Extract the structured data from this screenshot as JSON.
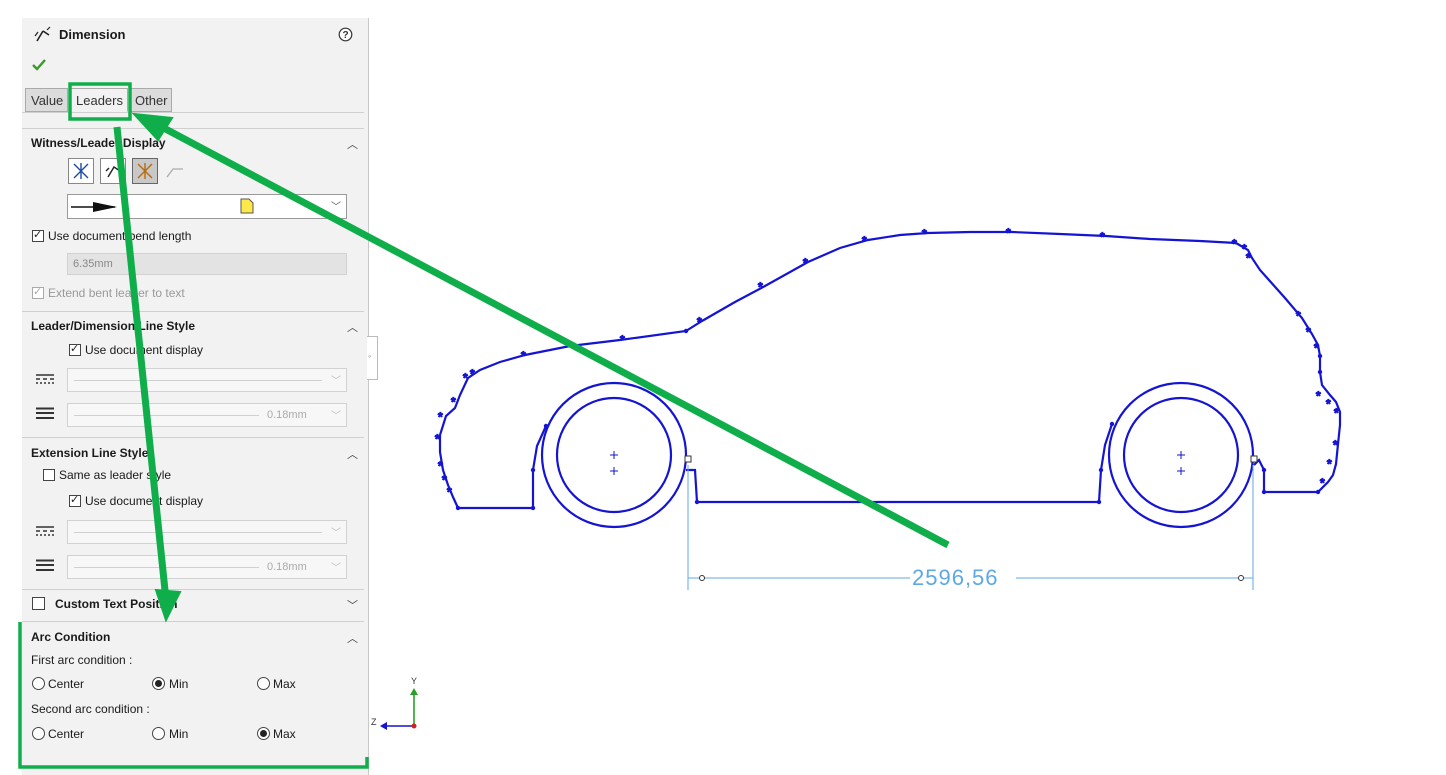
{
  "panel": {
    "title": "Dimension",
    "help_icon": "help-circle-icon",
    "ok_icon": "green-check-icon",
    "tabs": [
      {
        "label": "Value",
        "active": false
      },
      {
        "label": "Leaders",
        "active": true
      },
      {
        "label": "Other",
        "active": false
      }
    ],
    "witness_section": {
      "title": "Witness/Leader Display",
      "icons": [
        "outside-arrows-icon",
        "inside-arrows-icon",
        "smart-arrows-icon",
        "bent-leader-icon"
      ],
      "arrow_style_icon": "filled-arrow-style-icon",
      "use_document_bend_length": {
        "label": "Use document bend length",
        "checked": true
      },
      "bend_length_value": "6.35mm",
      "extend_bent_leader": {
        "label": "Extend bent leader to text",
        "checked": true,
        "enabled": false
      }
    },
    "leader_line_section": {
      "title": "Leader/Dimension Line Style",
      "use_document_display": {
        "label": "Use document display",
        "checked": true
      },
      "line_thickness_value": "0.18mm"
    },
    "extension_line_section": {
      "title": "Extension Line Style",
      "same_as_leader": {
        "label": "Same as leader style",
        "checked": false
      },
      "use_document_display": {
        "label": "Use document display",
        "checked": true
      },
      "line_thickness_value": "0.18mm"
    },
    "custom_text_position": {
      "label": "Custom Text Position",
      "checked": false
    },
    "arc_condition": {
      "title": "Arc Condition",
      "first_label": "First arc condition :",
      "second_label": "Second arc condition :",
      "options": [
        "Center",
        "Min",
        "Max"
      ],
      "first_selected": "Min",
      "second_selected": "Max"
    }
  },
  "canvas": {
    "dimension_value": "2596,56",
    "triad_labels": {
      "y": "Y",
      "z": "Z"
    },
    "sketch_color": "#1414d2",
    "dimension_color": "#5fa8e6",
    "annotation_color": "#0fae4a"
  }
}
